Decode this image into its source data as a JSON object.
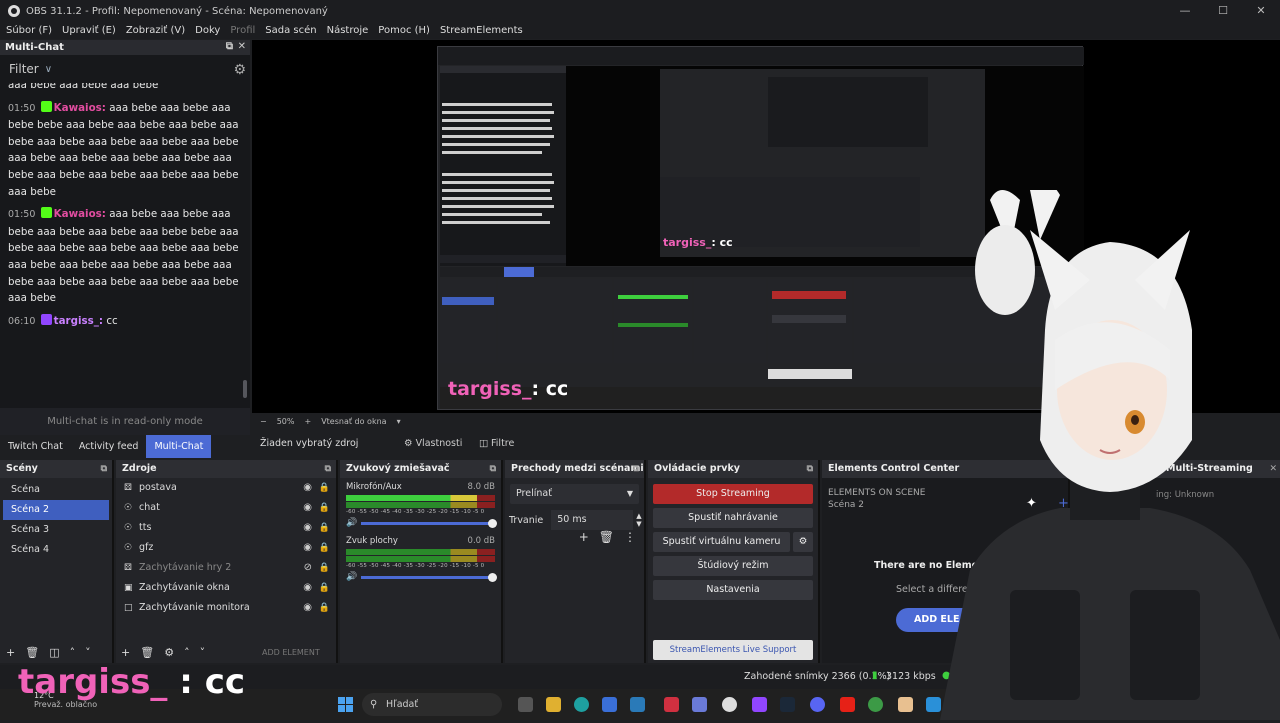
{
  "window": {
    "title": "OBS 31.1.2 - Profil: Nepomenovaný - Scéna: Nepomenovaný",
    "menu": [
      "Súbor (F)",
      "Upraviť (E)",
      "Zobraziť (V)",
      "Doky",
      "Profil",
      "Sada scén",
      "Nástroje",
      "Pomoc (H)",
      "StreamElements"
    ]
  },
  "multichat": {
    "title": "Multi-Chat",
    "filter_label": "Filter",
    "messages": [
      {
        "time": "",
        "user": "",
        "text": "aaa bebe aaa bebe aaa bebe"
      },
      {
        "time": "01:50",
        "user": "Kawaios:",
        "text": "aaa bebe aaa bebe aaa bebe bebe aaa bebe aaa bebe aaa bebe aaa bebe aaa bebe aaa bebe aaa bebe aaa bebe aaa bebe aaa bebe aaa bebe aaa bebe aaa bebe aaa bebe aaa bebe aaa bebe aaa bebe aaa bebe"
      },
      {
        "time": "01:50",
        "user": "Kawaios:",
        "text": "aaa bebe aaa bebe aaa bebe aaa bebe aaa bebe aaa bebe bebe aaa bebe aaa bebe aaa bebe aaa bebe aaa bebe aaa bebe aaa bebe aaa bebe aaa bebe aaa bebe aaa bebe aaa bebe aaa bebe aaa bebe aaa bebe"
      },
      {
        "time": "06:10",
        "user": "targiss_:",
        "text": "cc"
      }
    ],
    "readonly": "Multi-chat is in read-only mode"
  },
  "preview": {
    "zoom": "50%",
    "fit": "Vtesnať do okna",
    "overlay_user": "targiss_",
    "overlay_text": ": cc"
  },
  "tabs": [
    "Twitch Chat",
    "Activity feed",
    "Multi-Chat"
  ],
  "context": {
    "no_selection": "Žiaden vybratý zdroj",
    "properties": "Vlastnosti",
    "filters": "Filtre"
  },
  "scenes": {
    "title": "Scény",
    "items": [
      "Scéna",
      "Scéna 2",
      "Scéna 3",
      "Scéna 4"
    ]
  },
  "sources": {
    "title": "Zdroje",
    "items": [
      {
        "name": "postava",
        "icon": "gamepad-icon"
      },
      {
        "name": "chat",
        "icon": "globe-icon"
      },
      {
        "name": "tts",
        "icon": "globe-icon"
      },
      {
        "name": "gfz",
        "icon": "globe-icon"
      },
      {
        "name": "Zachytávanie hry 2",
        "icon": "gamepad-icon"
      },
      {
        "name": "Zachytávanie okna",
        "icon": "window-icon"
      },
      {
        "name": "Zachytávanie monitora",
        "icon": "monitor-icon"
      }
    ],
    "add_element": "ADD ELEMENT"
  },
  "mixer": {
    "title": "Zvukový zmiešavač",
    "channels": [
      {
        "name": "Mikrofón/Aux",
        "db": "8.0 dB"
      },
      {
        "name": "Zvuk plochy",
        "db": "0.0 dB"
      }
    ],
    "ticks": "-60 -55 -50 -45 -40 -35 -30 -25 -20 -15 -10 -5 0"
  },
  "transitions": {
    "title": "Prechody medzi scénami",
    "selected": "Prelínať",
    "duration_label": "Trvanie",
    "duration_value": "50 ms"
  },
  "controls": {
    "title": "Ovládacie prvky",
    "stop_streaming": "Stop Streaming",
    "start_recording": "Spustiť nahrávanie",
    "virtual_cam": "Spustiť virtuálnu kameru",
    "studio_mode": "Štúdiový režim",
    "settings": "Nastavenia",
    "live_support": "StreamElements Live Support"
  },
  "ecc": {
    "title": "Elements Control Center",
    "subtitle": "ELEMENTS ON SCENE",
    "scene": "Scéna 2",
    "empty": "There are no Elements",
    "select": "Select a differe",
    "add_button": "ADD ELE"
  },
  "multistream": {
    "title": "Multi-Streaming",
    "status": "ing: Unknown"
  },
  "status": {
    "dropped": "Zahodené snímky 2366 (0.1%)",
    "kbps": "3123 kbps",
    "extra": "16"
  },
  "taskbar": {
    "search": "Hľadať",
    "weather_temp": "12°C",
    "weather_desc": "Prevaž. oblačno"
  },
  "colors": {
    "accent": "#4c6bd5",
    "stop": "#b32a2a",
    "kick_user": "#e24da0",
    "twitch_user": "#c980ff",
    "overlay_user": "#f062b8"
  }
}
